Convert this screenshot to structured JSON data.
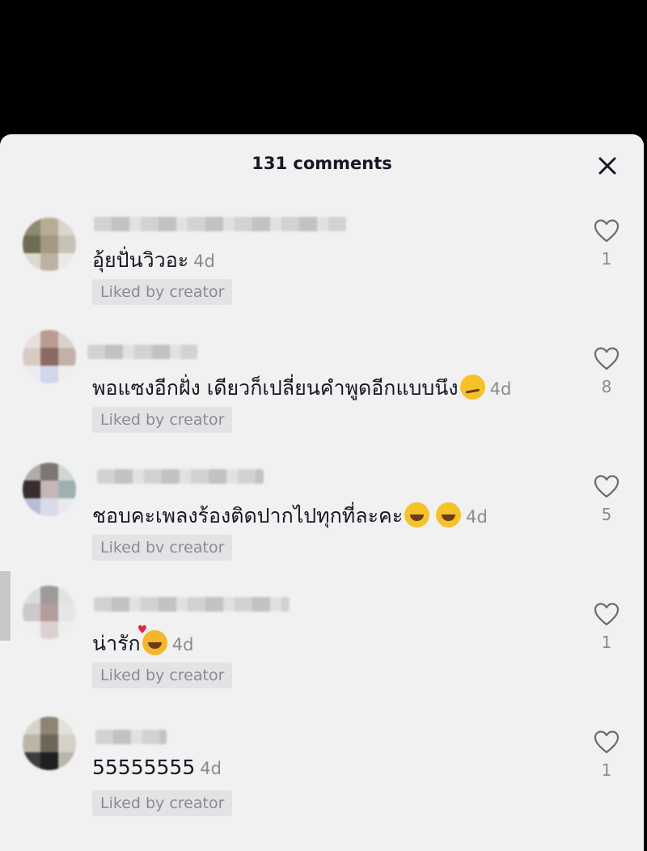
{
  "header": {
    "title": "131 comments",
    "close_icon": "close-icon"
  },
  "colors": {
    "background": "#000000",
    "sheet": "#f1f1f2",
    "text": "#161823",
    "muted": "#8a8b91",
    "badge": "#e3e3e6"
  },
  "comments": [
    {
      "text": "อุ้ยปั่นวิวอะ",
      "emoji": [],
      "time": "4d",
      "badge": "Liked by creator",
      "likes": "1",
      "like_icon": "heart-outline-icon"
    },
    {
      "text": "พอแซงอีกฝั่ง เดียวก็เปลี่ยนคำพูดอีกแบบนึง",
      "emoji": [
        "smirking-face-emoji"
      ],
      "time": "4d",
      "badge": "Liked by creator",
      "likes": "8",
      "like_icon": "heart-outline-icon"
    },
    {
      "text": "ชอบคะเพลงร้องติดปากไปทุกที่ละคะ",
      "emoji": [
        "grinning-face-emoji",
        "grinning-face-emoji"
      ],
      "time": "4d",
      "badge": "Liked bv creator",
      "likes": "5",
      "like_icon": "heart-outline-icon"
    },
    {
      "text": "น่ารัก",
      "emoji": [
        "smiling-face-with-hearts-emoji"
      ],
      "time": "4d",
      "badge": "Liked by creator",
      "likes": "1",
      "like_icon": "heart-outline-icon"
    },
    {
      "text": "55555555",
      "emoji": [],
      "time": "4d",
      "badge": "Liked by creator",
      "likes": "1",
      "like_icon": "heart-outline-icon"
    }
  ]
}
